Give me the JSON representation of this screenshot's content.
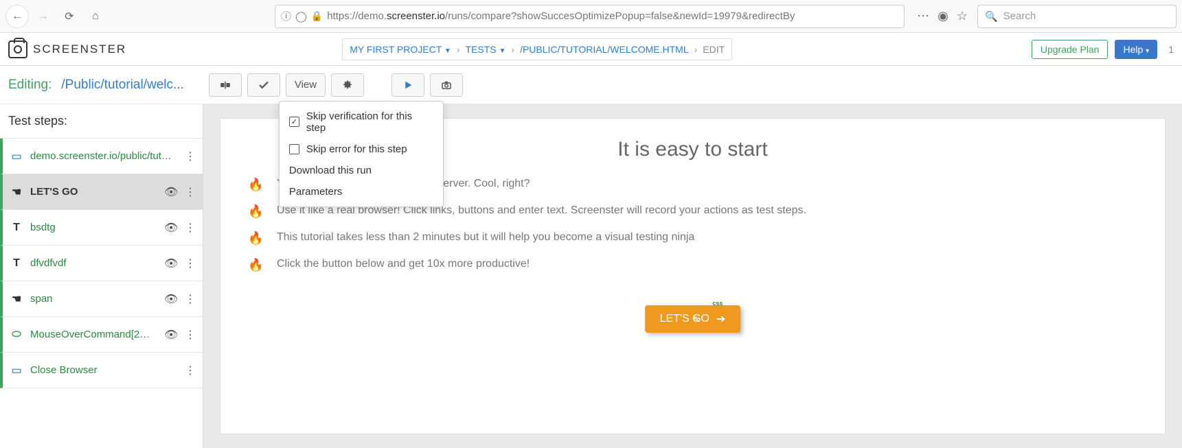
{
  "browser": {
    "url_prefix": "https://",
    "url_host_pre": "demo.",
    "url_host_strong": "screenster.io",
    "url_path": "/runs/compare?showSuccesOptimizePopup=false&newId=19979&redirectBy",
    "search_placeholder": "Search"
  },
  "header": {
    "logo_text": "SCREENSTER",
    "breadcrumbs": {
      "project": "MY FIRST PROJECT",
      "tests": "TESTS",
      "path": "/PUBLIC/TUTORIAL/WELCOME.HTML",
      "mode": "EDIT"
    },
    "upgrade": "Upgrade Plan",
    "help": "Help",
    "count": "1"
  },
  "toolbar": {
    "editing_label": "Editing:",
    "editing_path": "/Public/tutorial/welc...",
    "view": "View"
  },
  "dropdown": {
    "skip_verification": "Skip verification for this step",
    "skip_error": "Skip error for this step",
    "download": "Download this run",
    "parameters": "Parameters"
  },
  "sidebar": {
    "title": "Test steps:",
    "steps": [
      {
        "label": "demo.screenster.io/public/tut…",
        "icon": "browser"
      },
      {
        "label": "LET'S GO",
        "icon": "click",
        "selected": true
      },
      {
        "label": "bsdtg",
        "icon": "text"
      },
      {
        "label": "dfvdfvdf",
        "icon": "text"
      },
      {
        "label": "span",
        "icon": "click"
      },
      {
        "label": "MouseOverCommand[2…",
        "icon": "mouse"
      },
      {
        "label": "Close Browser",
        "icon": "browser"
      }
    ]
  },
  "preview": {
    "title": "It is easy to start",
    "lines": [
      "Yo                                                    into a browser running on the server. Cool, right?",
      "Use it like a real browser! Click links, buttons and enter text. Screenster will record your actions as test steps.",
      "This tutorial takes less than 2 minutes but it will help you become a visual testing ninja",
      "Click the button below and get 10x more productive!"
    ],
    "css_badge": "css",
    "cta": "LET'S GO"
  }
}
